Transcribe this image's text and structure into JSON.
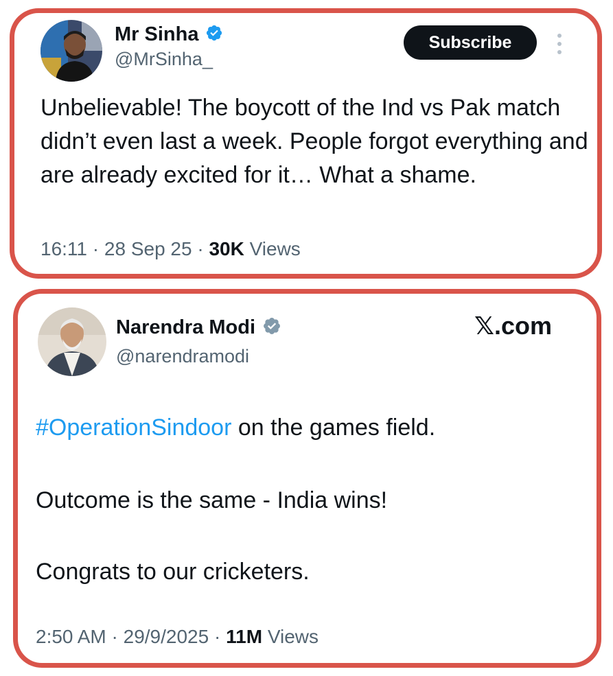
{
  "tweets": [
    {
      "name": "Mr Sinha",
      "handle": "@MrSinha_",
      "verified": true,
      "subscribe_label": "Subscribe",
      "text": "Unbelievable! The boycott of the Ind vs Pak match didn’t even last a week. People forgot everything and are already excited for it… What a shame.",
      "time": "16:11",
      "date": "28 Sep 25",
      "views_count": "30K",
      "views_label": "Views"
    },
    {
      "name": "Narendra Modi",
      "handle": "@narendramodi",
      "verified": true,
      "watermark": "𝕏.com",
      "hashtag": "#OperationSindoor",
      "line1_rest": " on the games field.",
      "line2": "Outcome is the same - India wins!",
      "line3": "Congrats to our cricketers.",
      "time": "2:50 AM",
      "date": "29/9/2025",
      "views_count": "11M",
      "views_label": "Views"
    }
  ],
  "colors": {
    "frame_border": "#d9544a",
    "verified_blue": "#1d9bf0",
    "verified_gray": "#829aab",
    "hashtag": "#1d9bf0",
    "secondary_text": "#536471"
  },
  "icons": [
    "verified-badge-icon",
    "more-options-icon"
  ]
}
